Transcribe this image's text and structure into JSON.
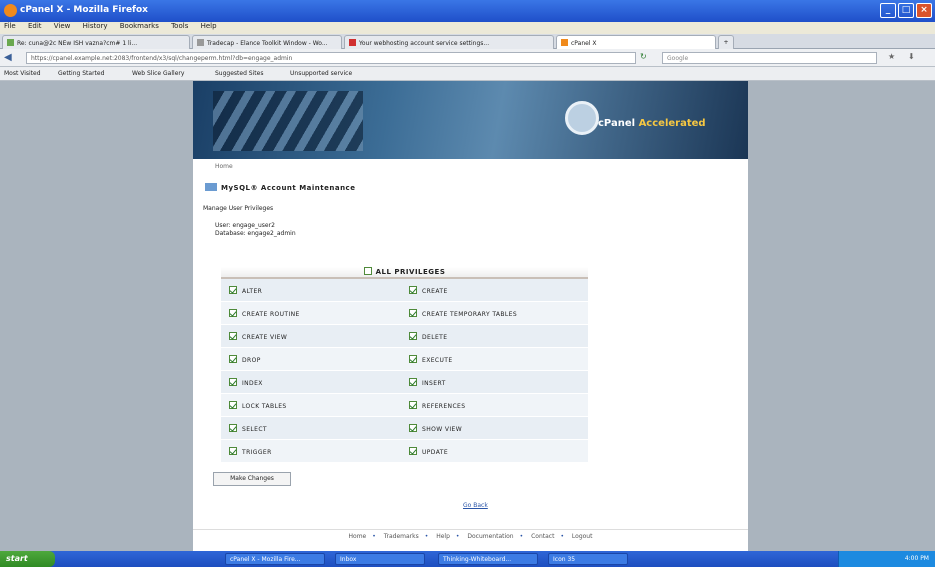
{
  "window": {
    "title": "cPanel X - Mozilla Firefox"
  },
  "menu": [
    "File",
    "Edit",
    "View",
    "History",
    "Bookmarks",
    "Tools",
    "Help"
  ],
  "tabs": [
    {
      "label": "Re: cuna@2c NEw ISH vazna?cm# 1 li..."
    },
    {
      "label": "Tradecap - Elance Toolkit Window - Wo..."
    },
    {
      "label": "Your webhosting account service settings..."
    },
    {
      "label": "cPanel X",
      "active": true
    }
  ],
  "nav": {
    "url": "https://cpanel.example.net:2083/frontend/x3/sql/changeperm.html?db=engage_admin",
    "search_placeholder": "Google"
  },
  "bookmarks": [
    "Most Visited",
    "Getting Started",
    "Web Slice Gallery",
    "Suggested Sites",
    "Unsupported service"
  ],
  "page": {
    "breadcrumb": "Home",
    "section_title": "MySQL® Account Maintenance",
    "manage_label": "Manage User Privileges",
    "user_line": "User: engage_user2",
    "db_line": "Database: engage2_admin",
    "all_privileges": "ALL PRIVILEGES",
    "privileges": [
      [
        "ALTER",
        "CREATE"
      ],
      [
        "CREATE ROUTINE",
        "CREATE TEMPORARY TABLES"
      ],
      [
        "CREATE VIEW",
        "DELETE"
      ],
      [
        "DROP",
        "EXECUTE"
      ],
      [
        "INDEX",
        "INSERT"
      ],
      [
        "LOCK TABLES",
        "REFERENCES"
      ],
      [
        "SELECT",
        "SHOW VIEW"
      ],
      [
        "TRIGGER",
        "UPDATE"
      ]
    ],
    "make_changes": "Make Changes",
    "go_back": "Go Back",
    "footer": [
      "Home",
      "Trademarks",
      "Help",
      "Documentation",
      "Contact",
      "Logout"
    ]
  },
  "branding": {
    "logo_text_1": "cPanel",
    "logo_text_2": "Accelerated"
  },
  "taskbar": {
    "start": "start",
    "items": [
      "cPanel X - Mozilla Fire...",
      "Inbox",
      "Thinking-Whiteboard...",
      "Icon 35"
    ],
    "clock": "4:00 PM"
  }
}
